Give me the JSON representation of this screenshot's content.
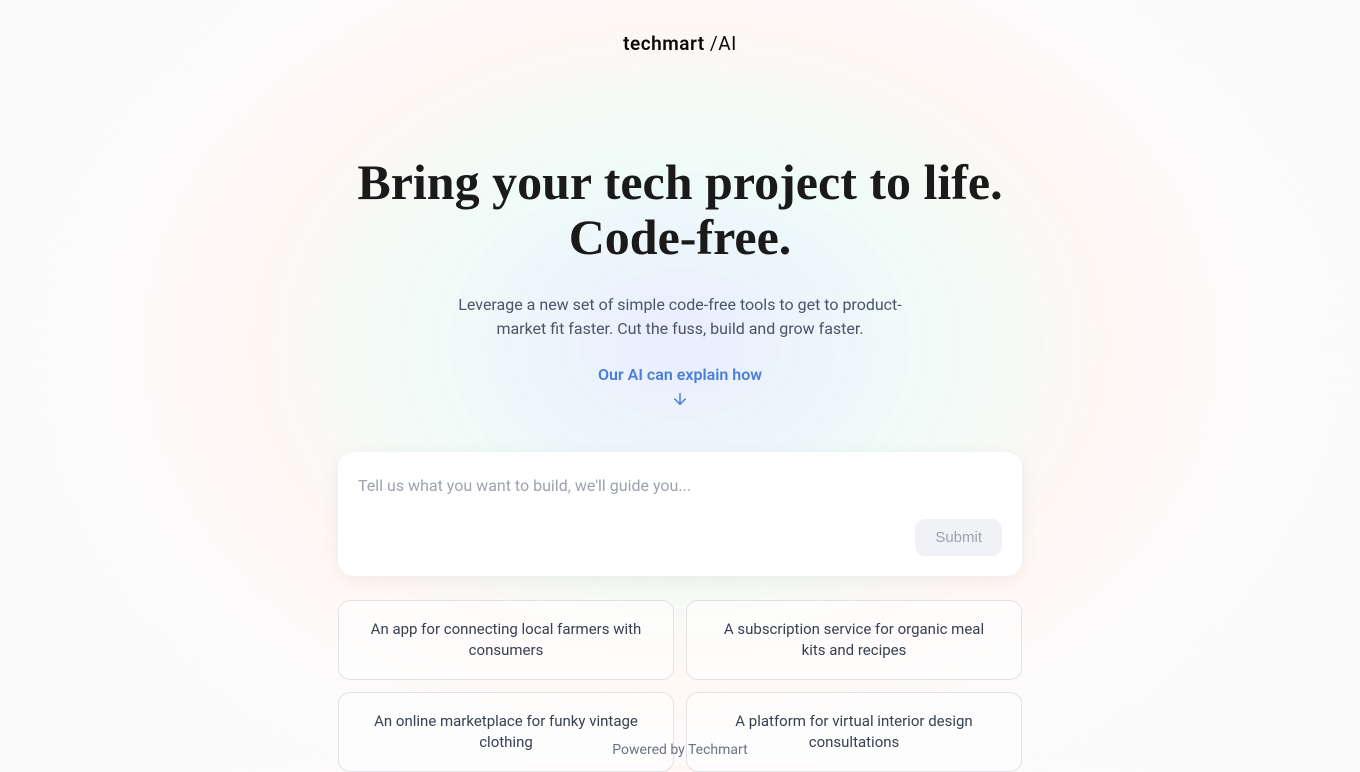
{
  "logo": {
    "text1": "techmart",
    "text2": " /AI"
  },
  "hero": {
    "headline_line1": "Bring your tech project to life.",
    "headline_line2": "Code-free.",
    "subheadline": "Leverage a new set of simple code-free tools to get to product-market fit faster. Cut the fuss, build and grow faster.",
    "ai_explain": "Our AI can explain how"
  },
  "input": {
    "placeholder": "Tell us what you want to build, we'll guide you...",
    "submit_label": "Submit"
  },
  "suggestions": [
    "An app for connecting local farmers with consumers",
    "A subscription service for organic meal kits and recipes",
    "An online marketplace for funky vintage clothing",
    "A platform for virtual interior design consultations"
  ],
  "footer": {
    "text": "Powered by Techmart"
  }
}
